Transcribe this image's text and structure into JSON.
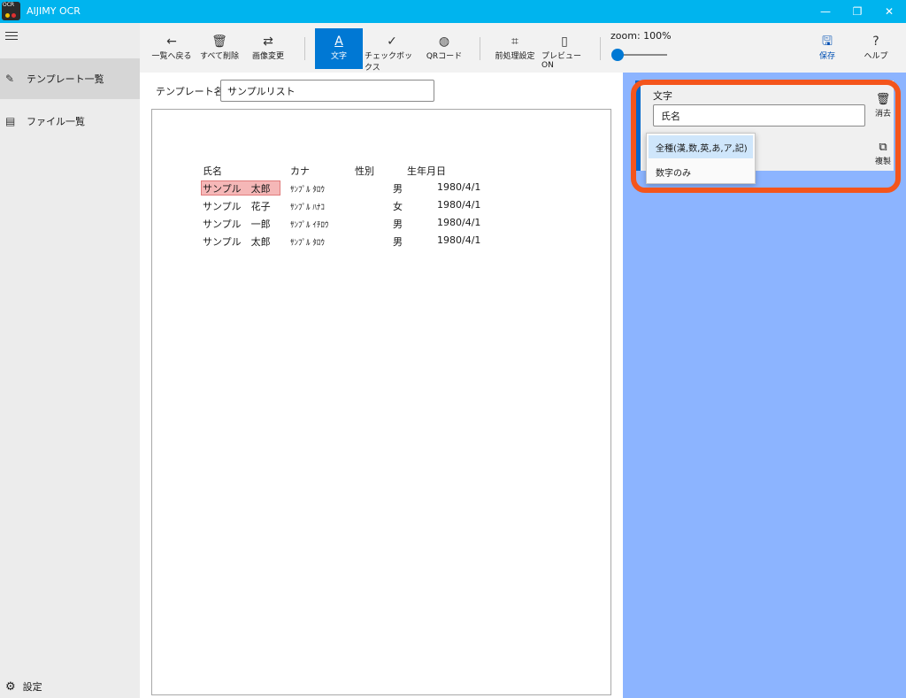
{
  "window": {
    "title": "AIJIMY OCR",
    "logo_text": "OCR",
    "controls": [
      "—",
      "❐",
      "✕"
    ]
  },
  "nav": {
    "items": [
      {
        "label": "テンプレート一覧",
        "icon": "edit-template-icon",
        "active": true
      },
      {
        "label": "ファイル一覧",
        "icon": "file-list-icon",
        "active": false
      }
    ],
    "settings_label": "設定"
  },
  "toolbar": {
    "back_label": "一覧へ戻る",
    "delete_all_label": "すべて削除",
    "change_image_label": "画像変更",
    "text_label": "文字",
    "checkbox_label": "チェックボックス",
    "qrcode_label": "QRコード",
    "preprocess_label": "前処理設定",
    "preview_label": "プレビューON",
    "zoom_label": "zoom:",
    "zoom_value": "100%",
    "zoom_level": 0,
    "save_label": "保存",
    "help_label": "ヘルプ"
  },
  "template": {
    "name_label": "テンプレート名：",
    "name_value": "サンプルリスト"
  },
  "document": {
    "headers": [
      "氏名",
      "カナ",
      "性別",
      "生年月日"
    ],
    "rows": [
      [
        "サンプル　太郎",
        "ｻﾝﾌﾟﾙ ﾀﾛｳ",
        "男",
        "1980/4/1"
      ],
      [
        "サンプル　花子",
        "ｻﾝﾌﾟﾙ ﾊﾅｺ",
        "女",
        "1980/4/1"
      ],
      [
        "サンプル　一郎",
        "ｻﾝﾌﾟﾙ ｲﾁﾛｳ",
        "男",
        "1980/4/1"
      ],
      [
        "サンプル　太郎",
        "ｻﾝﾌﾟﾙ ﾀﾛｳ",
        "男",
        "1980/4/1"
      ]
    ]
  },
  "field_panel": {
    "type_label": "文字",
    "field_value": "氏名",
    "delete_label": "消去",
    "duplicate_label": "複製",
    "dropdown_options": [
      "全種(漢,数,英,あ,ア,記)",
      "数字のみ"
    ],
    "selected_option": 0
  },
  "colors": {
    "titlebar": "#00b4ee",
    "accent": "#0078d4",
    "panel_bg": "#8cb4ff",
    "highlight_ring": "#f4551c",
    "selected_region": "#f5b7b7"
  }
}
